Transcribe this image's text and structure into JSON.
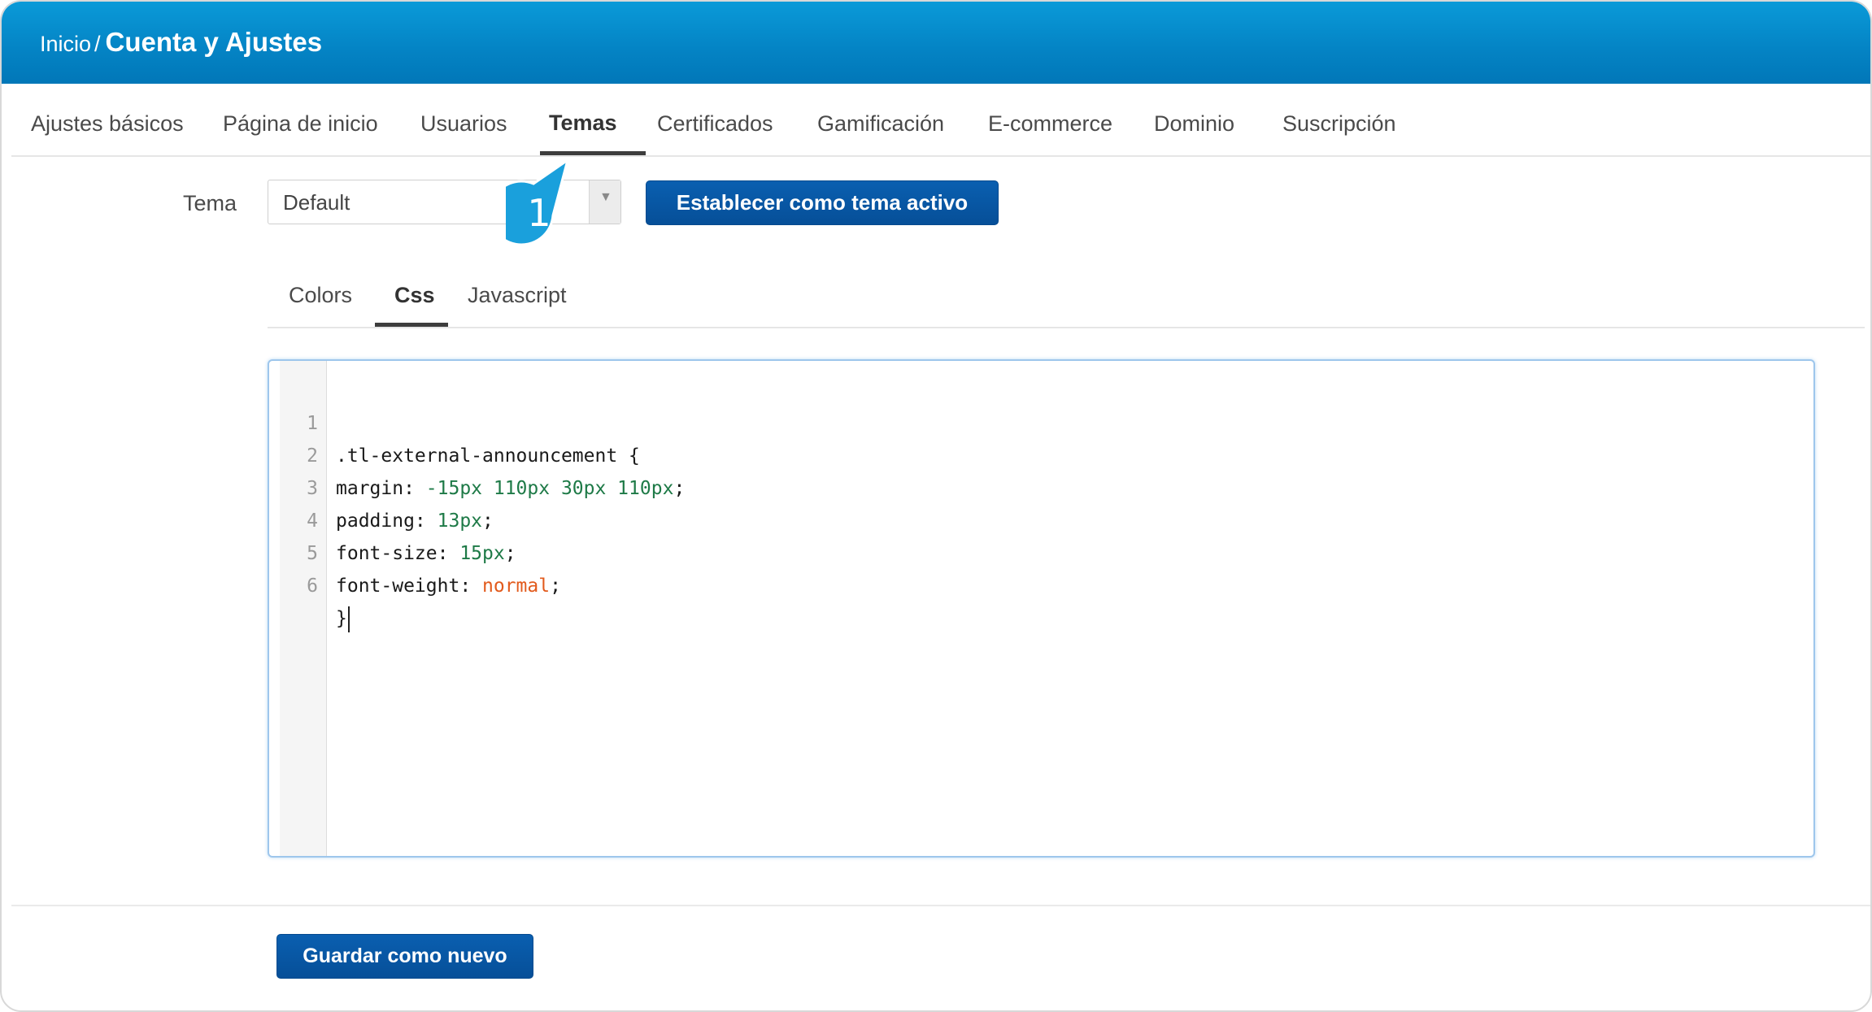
{
  "header": {
    "home": "Inicio",
    "separator": "/",
    "title": "Cuenta y Ajustes"
  },
  "main_tabs": [
    {
      "label": "Ajustes básicos"
    },
    {
      "label": "Página de inicio"
    },
    {
      "label": "Usuarios"
    },
    {
      "label": "Temas",
      "active": true
    },
    {
      "label": "Certificados"
    },
    {
      "label": "Gamificación"
    },
    {
      "label": "E-commerce"
    },
    {
      "label": "Dominio"
    },
    {
      "label": "Suscripción"
    }
  ],
  "theme": {
    "label": "Tema",
    "selected": "Default",
    "set_active_label": "Establecer como tema activo"
  },
  "callout": {
    "number": "1",
    "color": "#1aa0dc"
  },
  "sub_tabs": [
    {
      "label": "Colors"
    },
    {
      "label": "Css",
      "active": true
    },
    {
      "label": "Javascript"
    }
  ],
  "editor": {
    "lines": [
      {
        "n": "1",
        "text": ".tl-external-announcement {"
      },
      {
        "n": "2",
        "text": "margin: -15px 110px 30px 110px;"
      },
      {
        "n": "3",
        "text": "padding: 13px;"
      },
      {
        "n": "4",
        "text": "font-size: 15px;"
      },
      {
        "n": "5",
        "text": "font-weight: normal;"
      },
      {
        "n": "6",
        "text": "}"
      }
    ],
    "colors": {
      "number": "#1e7a47",
      "keyword": "#e25a1c"
    }
  },
  "footer": {
    "save_new_label": "Guardar como nuevo"
  },
  "colors": {
    "header_blue": "#0483c4",
    "button_blue": "#064f98"
  }
}
